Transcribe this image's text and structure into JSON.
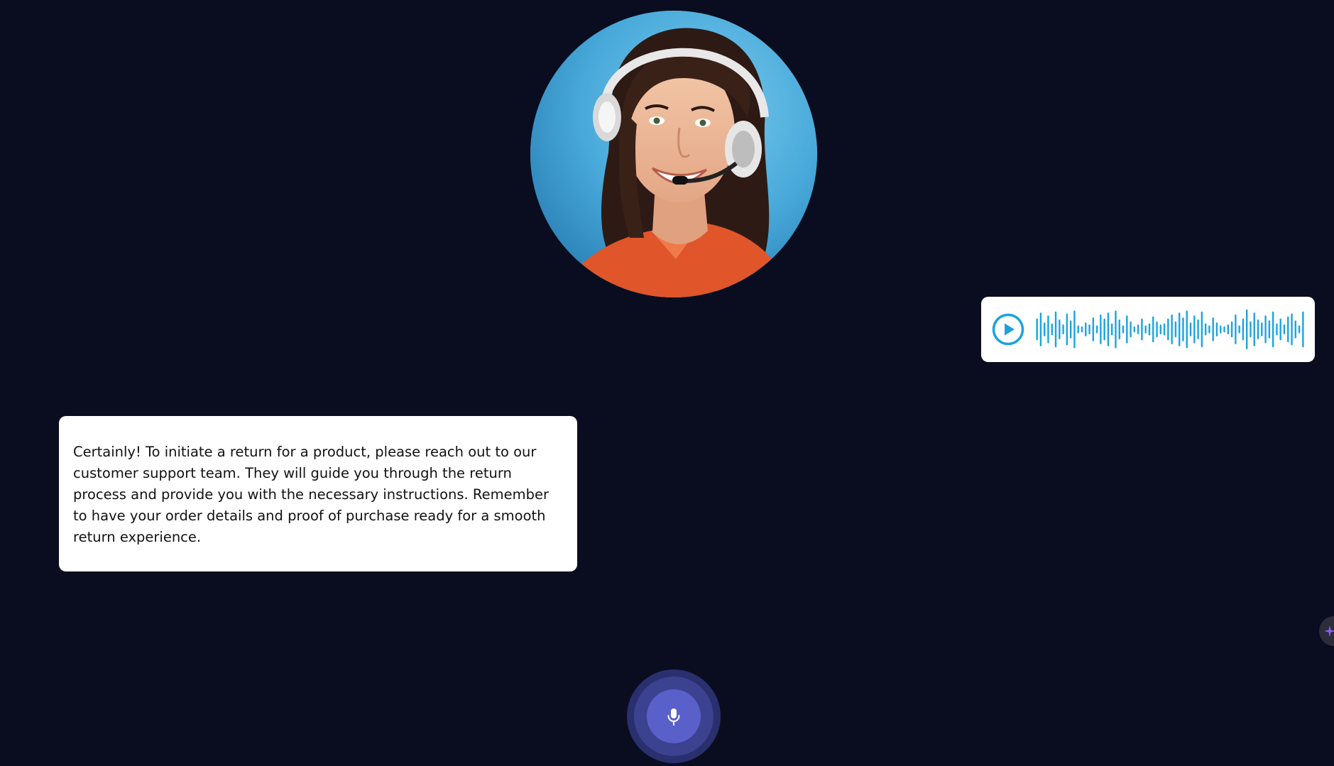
{
  "agent": {
    "avatar_icon": "support-agent-headset-photo"
  },
  "voice_message": {
    "play_icon": "play-circle-icon",
    "accent_color": "#1aa3dd",
    "waveform_levels": [
      0.55,
      0.85,
      0.35,
      0.7,
      0.3,
      0.9,
      0.5,
      0.25,
      0.8,
      0.45,
      0.95,
      0.2,
      0.15,
      0.35,
      0.25,
      0.6,
      0.2,
      0.75,
      0.55,
      0.85,
      0.3,
      0.95,
      0.5,
      0.2,
      0.7,
      0.4,
      0.15,
      0.25,
      0.55,
      0.2,
      0.3,
      0.65,
      0.4,
      0.25,
      0.3,
      0.55,
      0.75,
      0.4,
      0.85,
      0.6,
      0.95,
      0.35,
      0.7,
      0.5,
      0.9,
      0.3,
      0.2,
      0.6,
      0.35,
      0.2,
      0.15,
      0.25,
      0.4,
      0.75,
      0.2,
      0.55,
      1.0,
      0.4,
      0.85,
      0.5,
      0.35,
      0.7,
      0.45,
      0.9,
      0.3,
      0.55,
      0.25,
      0.65,
      0.8,
      0.45,
      0.2,
      0.9
    ]
  },
  "reply": {
    "text": "Certainly! To initiate a return for a product, please reach out to our customer support team. They will guide you through the return process and provide you with the necessary instructions. Remember to have your order details and proof of purchase ready for a smooth return experience."
  },
  "mic_button": {
    "icon": "microphone-icon",
    "colors": {
      "outer": "#2a2f6e",
      "middle": "#3c4190",
      "inner": "#5a60c9"
    }
  },
  "edge_widget": {
    "icon": "sparkle-icon",
    "color": "#8a5cf6"
  },
  "theme": {
    "background": "#0a0d1f"
  }
}
